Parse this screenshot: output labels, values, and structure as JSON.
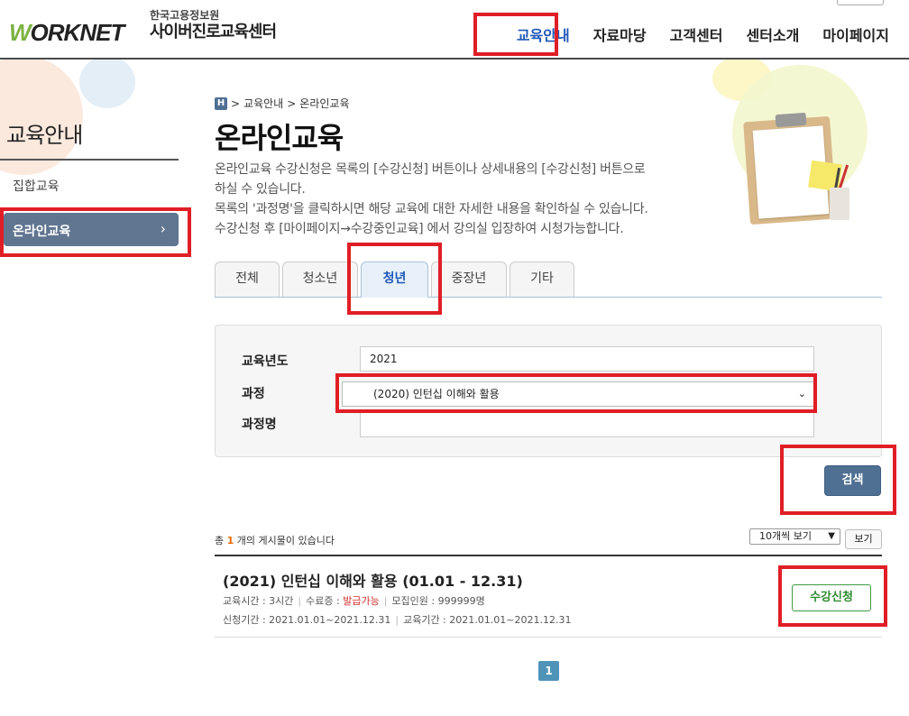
{
  "header": {
    "logo_text_1": "W",
    "logo_text_2": "ORKNET",
    "org_name": "한국고용정보원",
    "site_name": "사이버진로교육센터",
    "nav": [
      "교육안내",
      "자료마당",
      "고객센터",
      "센터소개",
      "마이페이지"
    ],
    "active_nav": "교육안내"
  },
  "sidebar": {
    "title": "교육안내",
    "items": [
      {
        "label": "집합교육",
        "active": false
      },
      {
        "label": "온라인교육",
        "active": true
      }
    ],
    "active_chevron": "›"
  },
  "breadcrumb": {
    "home_icon_text": "H",
    "items": [
      "교육안내",
      "온라인교육"
    ],
    "separator": ">"
  },
  "page": {
    "title": "온라인교육",
    "intro_lines": [
      "온라인교육 수강신청은 목록의 [수강신청] 버튼이나 상세내용의 [수강신청] 버튼으로",
      "하실 수 있습니다.",
      "목록의 '과정명'을 클릭하시면 해당 교육에 대한 자세한 내용을 확인하실 수 있습니다.",
      "수강신청 후 [마이페이지→수강중인교육] 에서 강의실 입장하여 시청가능합니다."
    ]
  },
  "tabs": [
    "전체",
    "청소년",
    "청년",
    "중장년",
    "기타"
  ],
  "active_tab": "청년",
  "search_form": {
    "year_label": "교육년도",
    "year_value": "2021",
    "course_label": "과정",
    "course_selected": "(2020) 인턴십 이해와 활용",
    "course_name_label": "과정명",
    "course_name_value": "",
    "search_button": "검색"
  },
  "list": {
    "count_prefix": "총",
    "count": "1",
    "count_suffix": "개의 게시물이 있습니다",
    "per_page_selected": "10개씩 보기",
    "view_button": "보기",
    "items": [
      {
        "title": "(2021) 인턴십 이해와 활용 (01.01 - 12.31)",
        "hours": "교육시간 : 3시간",
        "cert_label": "수료증 : ",
        "cert_value": "발급가능",
        "capacity": "모집인원 : 999999명",
        "apply_period": "신청기간 : 2021.01.01~2021.12.31",
        "edu_period": "교육기간 : 2021.01.01~2021.12.31",
        "apply_button": "수강신청"
      }
    ]
  },
  "pagination": {
    "current": "1"
  },
  "colors": {
    "highlight": "#e01e25",
    "primary": "#4f6f93",
    "nav_active": "#1f58b8",
    "apply_green": "#2e8b30"
  }
}
